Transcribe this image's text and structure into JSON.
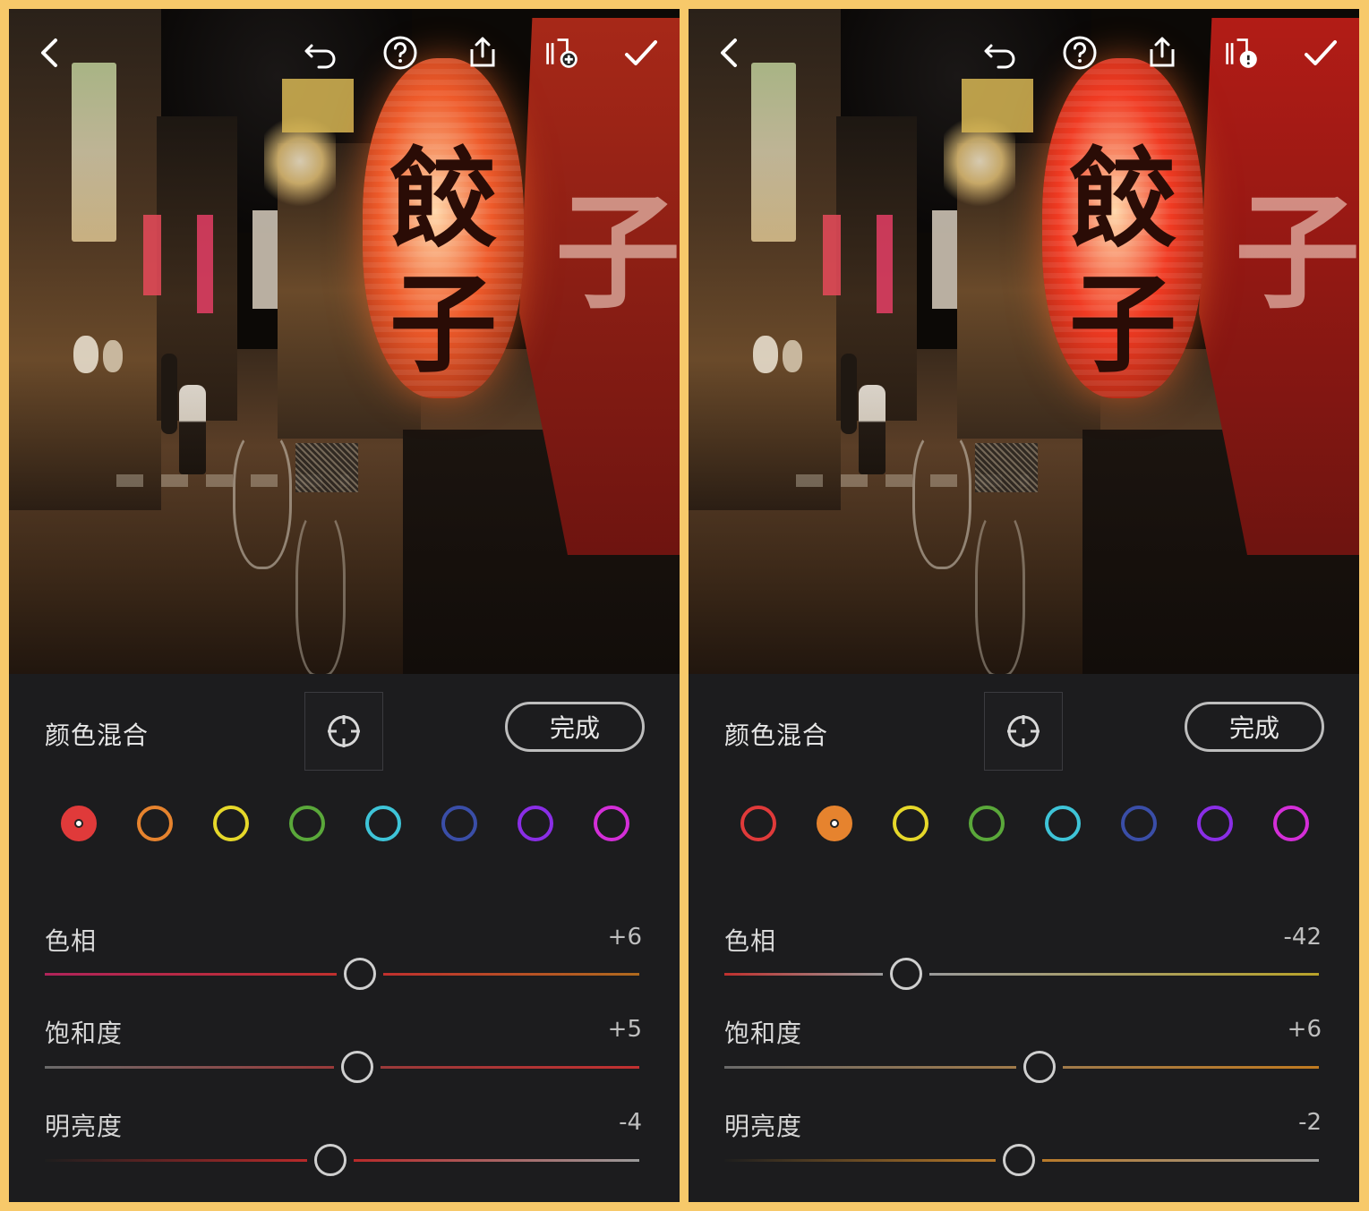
{
  "panels": [
    {
      "id": "left",
      "header": {
        "title": "颜色混合",
        "done_label": "完成"
      },
      "toolbar": {
        "back": "chevron-left-icon",
        "undo": "undo-icon",
        "help": "help-icon",
        "share": "share-icon",
        "presets": "add-preset-icon",
        "confirm": "checkmark-icon"
      },
      "swatches": [
        "#e03a3a",
        "#e6832e",
        "#e6d82a",
        "#5aa83a",
        "#3ec4d8",
        "#3a4ea8",
        "#8a2ee6",
        "#d42ed8"
      ],
      "selected_swatch": 0,
      "sliders": [
        {
          "label": "色相",
          "value": "+6",
          "level": 0.53,
          "gradient": [
            "#b0245a",
            "#c0302e",
            "#b06a1e"
          ]
        },
        {
          "label": "饱和度",
          "value": "+5",
          "level": 0.525,
          "gradient": [
            "#6a6a6a",
            "#9a3a3a",
            "#c23030"
          ]
        },
        {
          "label": "明亮度",
          "value": "-4",
          "level": 0.48,
          "gradient": [
            "#1e1e1e",
            "#b82a2a",
            "#9a9a9a"
          ]
        }
      ],
      "photo": {
        "lantern_text_top": "餃",
        "lantern_text_bottom": "子",
        "noren_text": "子",
        "lantern_color": "#ee5a2a",
        "curtain_color": "#a72818"
      }
    },
    {
      "id": "right",
      "header": {
        "title": "颜色混合",
        "done_label": "完成"
      },
      "toolbar": {
        "back": "chevron-left-icon",
        "undo": "undo-icon",
        "help": "help-icon",
        "share": "share-icon",
        "presets": "preset-warning-icon",
        "confirm": "checkmark-icon"
      },
      "swatches": [
        "#e03a3a",
        "#e6832e",
        "#e6d82a",
        "#5aa83a",
        "#3ec4d8",
        "#3a4ea8",
        "#8a2ee6",
        "#d42ed8"
      ],
      "selected_swatch": 1,
      "sliders": [
        {
          "label": "色相",
          "value": "-42",
          "level": 0.305,
          "gradient": [
            "#c0302e",
            "#9a9a9a",
            "#b8a22a"
          ]
        },
        {
          "label": "饱和度",
          "value": "+6",
          "level": 0.53,
          "gradient": [
            "#6a6a6a",
            "#a07a4a",
            "#c07a20"
          ]
        },
        {
          "label": "明亮度",
          "value": "-2",
          "level": 0.495,
          "gradient": [
            "#1e1e1e",
            "#b87a2a",
            "#9a9a9a"
          ]
        }
      ],
      "photo": {
        "lantern_text_top": "餃",
        "lantern_text_bottom": "子",
        "noren_text": "子",
        "lantern_color": "#f03a22",
        "curtain_color": "#b21c16"
      }
    }
  ]
}
